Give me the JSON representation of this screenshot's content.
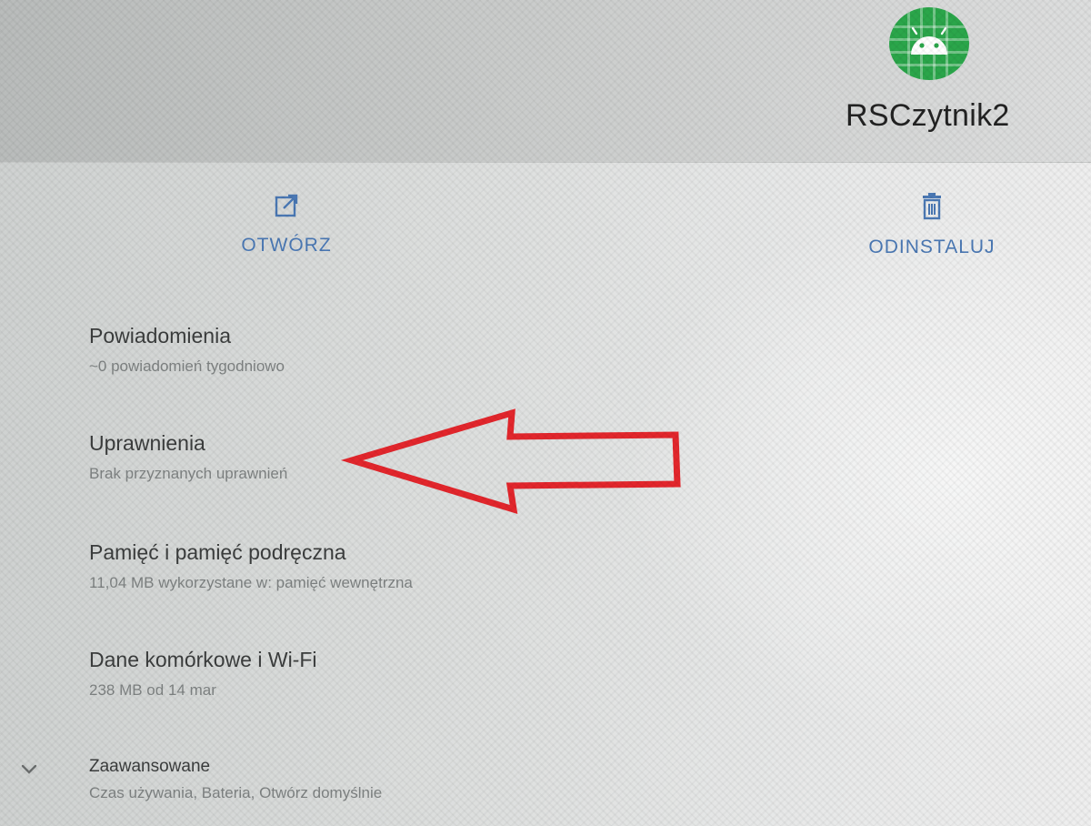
{
  "app": {
    "name": "RSCzytnik2",
    "icon": "android-robot-icon",
    "icon_color": "#2aa64a"
  },
  "actions": {
    "open_label": "OTWÓRZ",
    "uninstall_label": "ODINSTALUJ",
    "accent_color": "#4a78b4"
  },
  "settings": {
    "notifications": {
      "title": "Powiadomienia",
      "subtitle": "~0 powiadomień tygodniowo"
    },
    "permissions": {
      "title": "Uprawnienia",
      "subtitle": "Brak przyznanych uprawnień"
    },
    "storage": {
      "title": "Pamięć i pamięć podręczna",
      "subtitle": "11,04 MB wykorzystane w: pamięć wewnętrzna"
    },
    "data": {
      "title": "Dane komórkowe i Wi-Fi",
      "subtitle": "238 MB od 14 mar"
    },
    "advanced": {
      "title": "Zaawansowane",
      "subtitle": "Czas używania, Bateria, Otwórz domyślnie"
    }
  },
  "annotation": {
    "arrow_color": "#e3262c"
  }
}
